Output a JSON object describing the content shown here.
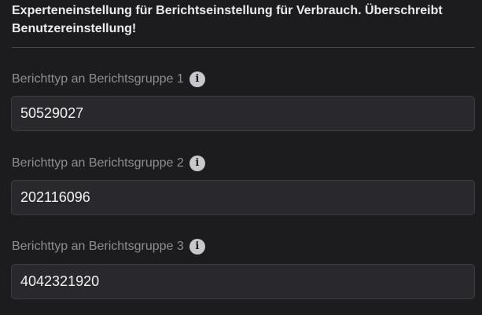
{
  "section": {
    "heading": "Experteneinstellung für Berichtseinstellung für Verbrauch. Überschreibt Benutzereinstellung!"
  },
  "fields": [
    {
      "label": "Berichttyp an Berichtsgruppe 1",
      "value": "50529027",
      "info_icon": "info-circle-icon"
    },
    {
      "label": "Berichttyp an Berichtsgruppe 2",
      "value": "202116096",
      "info_icon": "info-circle-icon"
    },
    {
      "label": "Berichttyp an Berichtsgruppe 3",
      "value": "4042321920",
      "info_icon": "info-circle-icon"
    }
  ],
  "colors": {
    "background": "#1c1c1e",
    "input_background": "#29292d",
    "input_border": "#3c3c41",
    "label_text": "#8e8e92",
    "heading_text": "#ececec"
  }
}
